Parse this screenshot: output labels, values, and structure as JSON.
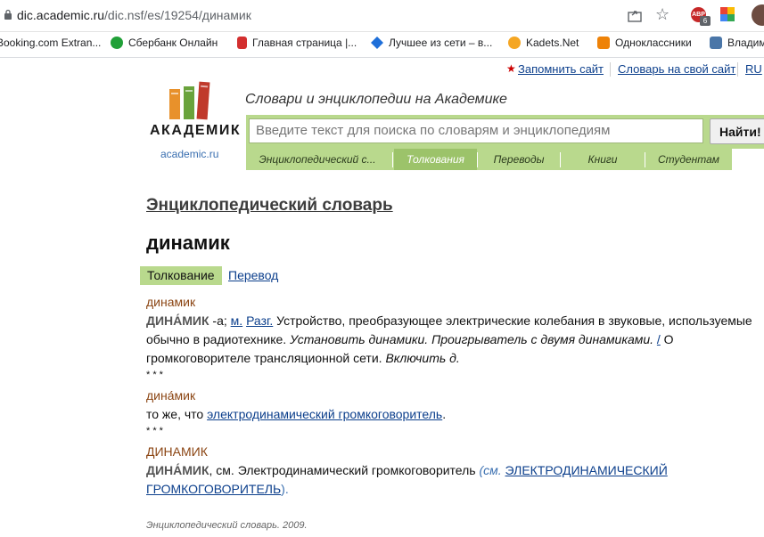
{
  "browser": {
    "url_host": "dic.academic.ru",
    "url_path": "/dic.nsf/es/19254/динамик",
    "ext_label": "ABP",
    "ext_badge": "6"
  },
  "bookmarks": [
    {
      "label": "Booking.com Extran..."
    },
    {
      "label": "Сбербанк Онлайн"
    },
    {
      "label": "Главная страница |..."
    },
    {
      "label": "Лучшее из сети – в..."
    },
    {
      "label": "Kadets.Net"
    },
    {
      "label": "Одноклассники"
    },
    {
      "label": "Владим"
    }
  ],
  "site": {
    "remember": "Запомнить сайт",
    "dict_to_site": "Словарь на свой сайт",
    "lang": "RU",
    "logo_text": "АКАДЕМИК",
    "logo_sub": "academic.ru",
    "tagline": "Словари и энциклопедии на Академике",
    "search_placeholder": "Введите текст для поиска по словарям и энциклопедиям",
    "search_button": "Найти!",
    "tabs": [
      {
        "label": "Энциклопедический с..."
      },
      {
        "label": "Толкования"
      },
      {
        "label": "Переводы"
      },
      {
        "label": "Книги"
      },
      {
        "label": "Студентам"
      }
    ]
  },
  "content": {
    "dict_title": "Энциклопедический словарь",
    "word": "динамик",
    "subtab_active": "Толкование",
    "subtab_link": "Перевод",
    "e1_headword": "динамик",
    "e1_bold": "ДИНА́МИК",
    "e1_a": " -а; ",
    "e1_m": "м.",
    "e1_razg": "Разг.",
    "e1_text1": " Устройство, преобразующее электрические колебания в звуковые, используемые обычно в радиотехнике. ",
    "e1_ital1": "Установить динамики. Проигрыватель с двумя динамиками. ",
    "e1_link": "/",
    "e1_text2": " О громкоговорителе трансляционной сети. ",
    "e1_ital2": "Включить д.",
    "sep1": "* * *",
    "e2_headword": "дина́мик",
    "e2_text": "то же, что ",
    "e2_link": "электродинамический громкоговоритель",
    "e2_dot": ".",
    "sep2": "* * *",
    "e3_headword": "ДИНАМИК",
    "e3_bold": "ДИНА́МИК",
    "e3_text": ", см. Электродинамический громкоговоритель ",
    "e3_sm": "(см. ",
    "e3_link": "ЭЛЕКТРОДИНАМИЧЕСКИЙ ГРОМКОГОВОРИТЕЛЬ",
    "e3_close": ").",
    "source": "Энциклопедический словарь. 2009."
  }
}
